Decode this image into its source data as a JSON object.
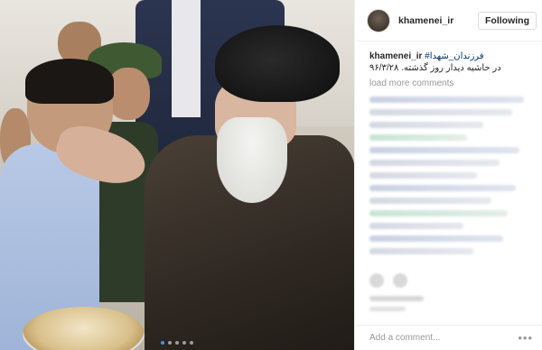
{
  "post": {
    "username": "khamenei_ir",
    "follow_label": "Following",
    "caption_user": "khamenei_ir",
    "caption_hashtag": "#فرزندان_شهدا",
    "caption_text": "در حاشیه دیدار روز گذشته. ۹۶/۳/۲۸",
    "load_more_label": "load more comments",
    "add_comment_placeholder": "Add a comment...",
    "more_options_glyph": "•••"
  },
  "carousel": {
    "dot_count": 5,
    "active_index": 0
  },
  "colors": {
    "link": "#003569",
    "active_dot": "#3897f0",
    "muted": "#999999"
  },
  "icons": {
    "avatar": "profile-avatar",
    "more": "more-options-icon",
    "like": "heart-icon",
    "comment": "comment-icon"
  }
}
